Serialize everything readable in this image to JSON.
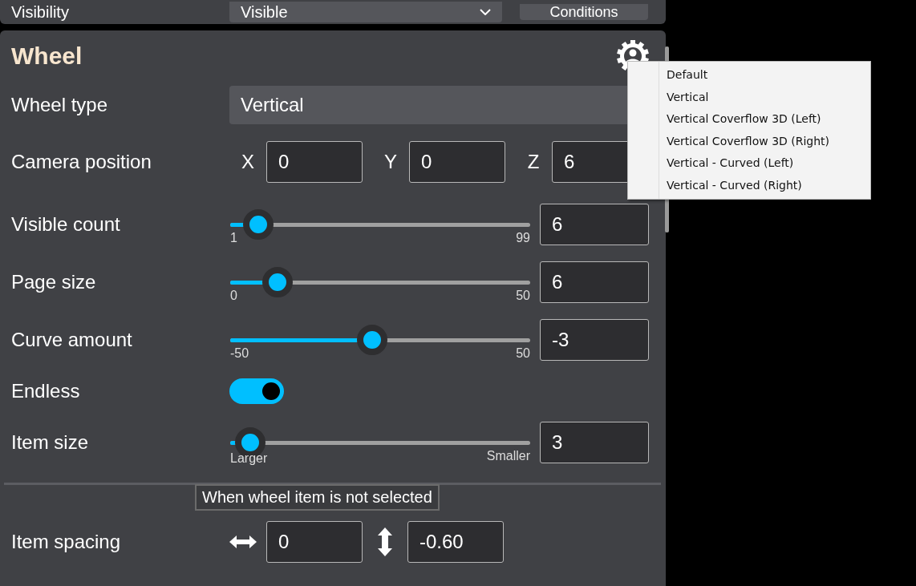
{
  "top_row": {
    "label": "Visibility",
    "value": "Visible",
    "button": "Conditions"
  },
  "section": {
    "title": "Wheel"
  },
  "wheel_type": {
    "label": "Wheel type",
    "value": "Vertical"
  },
  "camera_position": {
    "label": "Camera position",
    "fields": [
      {
        "axis": "X",
        "value": "0"
      },
      {
        "axis": "Y",
        "value": "0"
      },
      {
        "axis": "Z",
        "value": "6"
      }
    ]
  },
  "rows": [
    {
      "kind": "slider",
      "label": "Visible count",
      "min_label": "1",
      "max_label": "99",
      "level": 0.051,
      "value": "6"
    },
    {
      "kind": "slider",
      "label": "Page size",
      "min_label": "0",
      "max_label": "50",
      "level": 0.12,
      "value": "6"
    },
    {
      "kind": "slider",
      "label": "Curve amount",
      "min_label": "-50",
      "max_label": "50",
      "level": 0.47,
      "value": "-3"
    },
    {
      "kind": "toggle",
      "label": "Endless",
      "on": true
    },
    {
      "kind": "slider",
      "label": "Item size",
      "min_label": "Larger",
      "max_label": "Smaller",
      "level": 0.02,
      "value": "3"
    }
  ],
  "tooltip": "When wheel item is not selected",
  "item_spacing": {
    "label": "Item spacing",
    "horizontal": "0",
    "vertical": "-0.60"
  },
  "dropdown_menu": {
    "items": [
      "Default",
      "Vertical",
      "Vertical Coverflow 3D (Left)",
      "Vertical Coverflow 3D (Right)",
      "Vertical - Curved (Left)",
      "Vertical - Curved (Right)"
    ]
  }
}
